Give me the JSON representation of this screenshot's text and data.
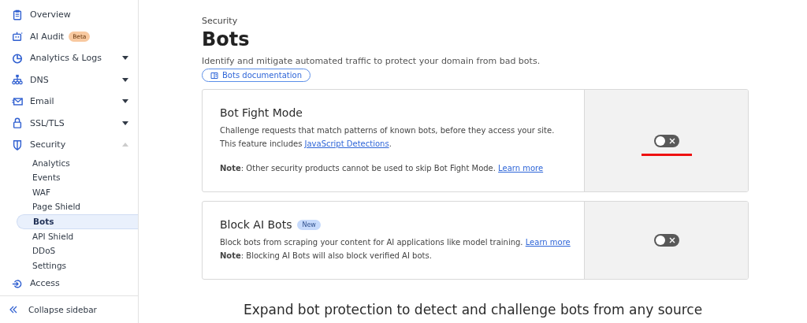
{
  "sidebar": {
    "items": [
      {
        "label": "Overview"
      },
      {
        "label": "AI Audit",
        "badge": "Beta"
      },
      {
        "label": "Analytics & Logs",
        "expanded": false
      },
      {
        "label": "DNS",
        "expanded": false
      },
      {
        "label": "Email",
        "expanded": false
      },
      {
        "label": "SSL/TLS",
        "expanded": false
      },
      {
        "label": "Security",
        "expanded": true,
        "children": [
          {
            "label": "Analytics",
            "selected": false
          },
          {
            "label": "Events",
            "selected": false
          },
          {
            "label": "WAF",
            "selected": false
          },
          {
            "label": "Page Shield",
            "selected": false
          },
          {
            "label": "Bots",
            "selected": true
          },
          {
            "label": "API Shield",
            "selected": false
          },
          {
            "label": "DDoS",
            "selected": false
          },
          {
            "label": "Settings",
            "selected": false
          }
        ]
      },
      {
        "label": "Access"
      }
    ],
    "collapse": "Collapse sidebar"
  },
  "header": {
    "breadcrumb": "Security",
    "title": "Bots",
    "description": "Identify and mitigate automated traffic to protect your domain from bad bots.",
    "doc_button": "Bots documentation"
  },
  "cards": [
    {
      "title": "Bot Fight Mode",
      "description": "Challenge requests that match patterns of known bots, before they access your site. This feature includes ",
      "description_link": "JavaScript Detections",
      "description_end": ".",
      "note_label": "Note",
      "note": ": Other security products cannot be used to skip Bot Fight Mode. ",
      "note_link": "Learn more",
      "on": false,
      "annotated": true
    },
    {
      "title": "Block AI Bots",
      "badge": "New",
      "description": "Block bots from scraping your content for AI applications like model training. ",
      "description_link": "Learn more",
      "note_label": "Note",
      "note": ": Blocking AI Bots will also block verified AI bots.",
      "on": false,
      "annotated": false
    }
  ],
  "footer_heading": "Expand bot protection to detect and challenge bots from any source"
}
